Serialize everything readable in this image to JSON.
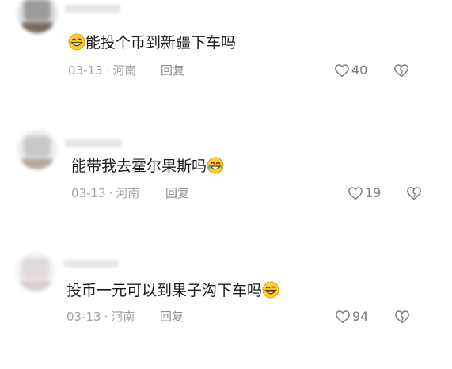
{
  "comments": [
    {
      "username": "",
      "text": "能投个币到新疆下车吗",
      "emoji_position": "before",
      "emoji_icon": "grinning-emoji-icon",
      "date": "03-13",
      "separator": "·",
      "location": "河南",
      "reply_label": "回复",
      "likes": "40"
    },
    {
      "username": "",
      "text": "能带我去霍尔果斯吗",
      "emoji_position": "after",
      "emoji_icon": "tears-of-joy-emoji-icon",
      "date": "03-13",
      "separator": "·",
      "location": "河南",
      "reply_label": "回复",
      "likes": "19"
    },
    {
      "username": "",
      "text": "投币一元可以到果子沟下车吗",
      "emoji_position": "after",
      "emoji_icon": "grinning-emoji-icon",
      "date": "03-13",
      "separator": "·",
      "location": "河南",
      "reply_label": "回复",
      "likes": "94"
    }
  ],
  "colors": {
    "text": "#1c1c1c",
    "meta": "#a3a3a3",
    "icon": "#7c7c7c",
    "emoji_face": "#ffcc33"
  }
}
